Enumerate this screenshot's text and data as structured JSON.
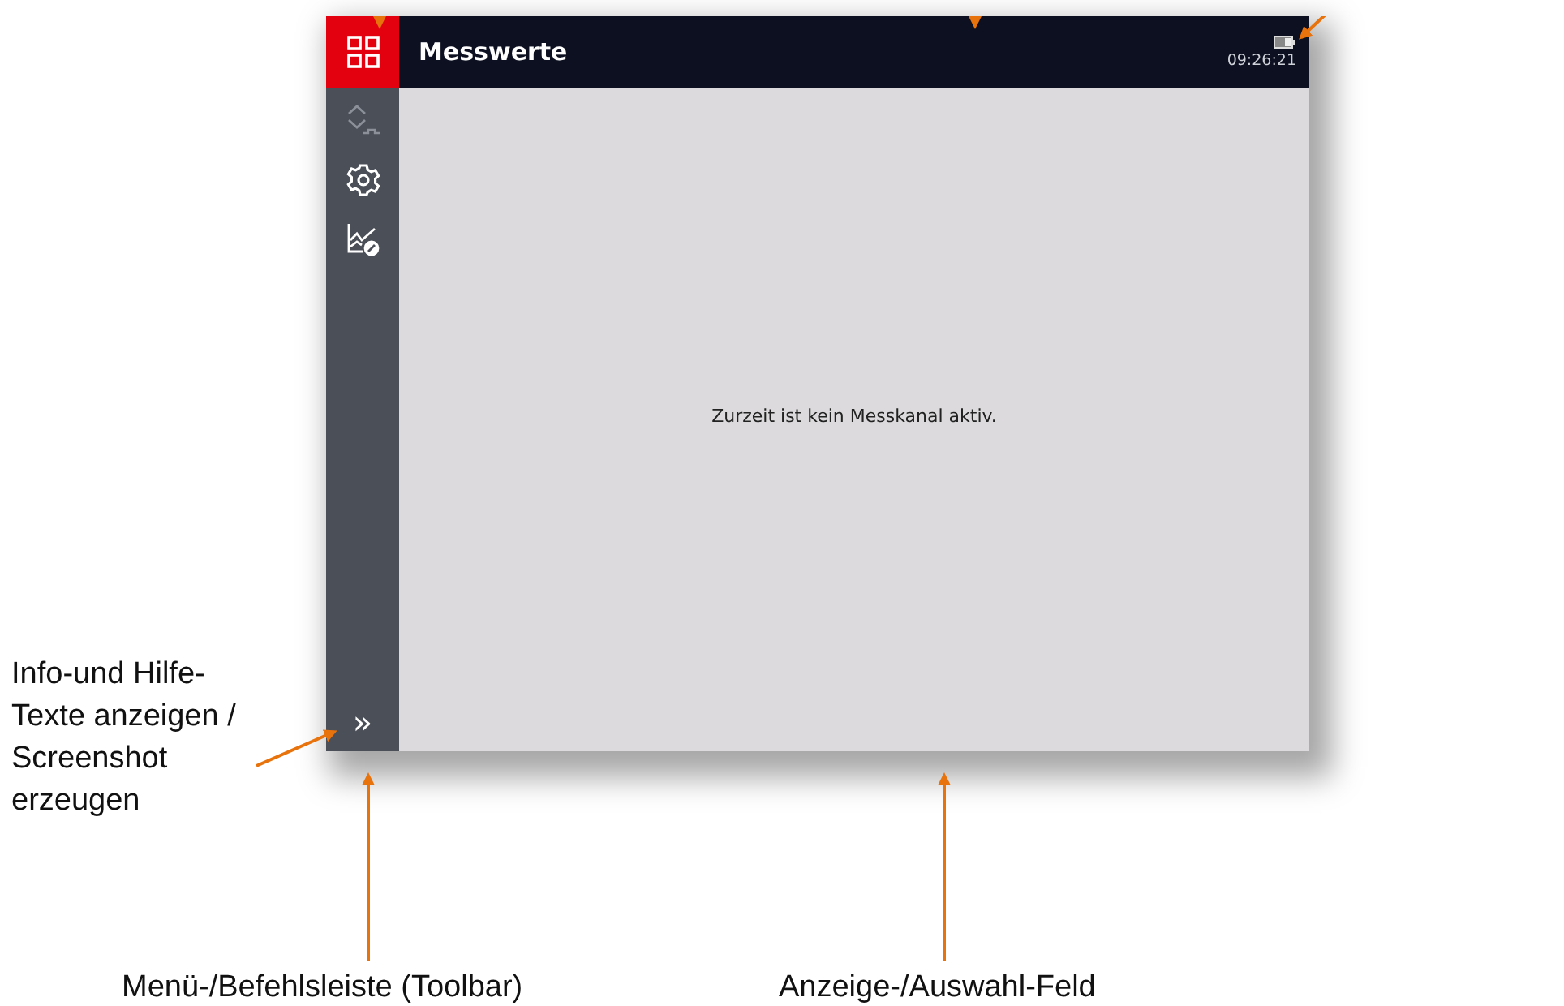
{
  "screen": {
    "home_button": {
      "selected": true
    },
    "title": "Messwerte",
    "clock": "09:26:21",
    "toolbar": [
      {
        "kind": "updown",
        "disabled": true
      },
      {
        "kind": "settings",
        "disabled": false
      },
      {
        "kind": "chart",
        "disabled": false
      }
    ],
    "expand_button": "»",
    "message": "Zurzeit ist kein Messkanal aktiv."
  },
  "annotations": {
    "left": [
      "Info-und Hilfe-",
      "Texte anzeigen /",
      "Screenshot",
      "erzeugen"
    ],
    "toolbar": "Menü-/Befehlsleiste (Toolbar)",
    "display": "Anzeige-/Auswahl-Feld"
  }
}
